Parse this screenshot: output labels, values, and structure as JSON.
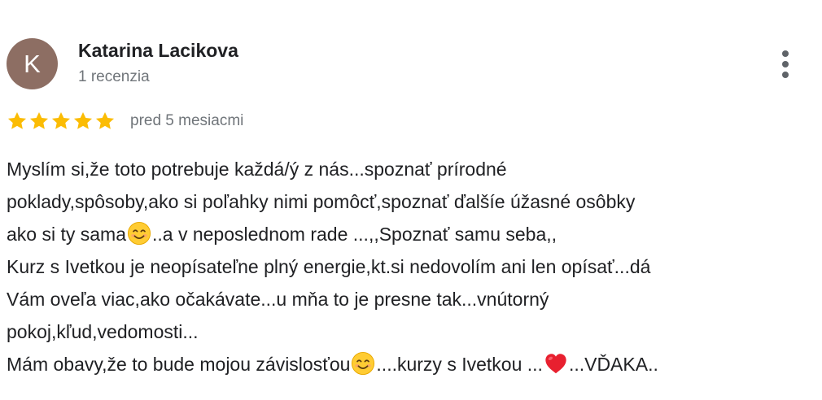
{
  "review": {
    "author": {
      "name": "Katarina Lacikova",
      "initial": "K",
      "review_count": "1 recenzia",
      "avatar_color": "#8d6e63"
    },
    "menu_icon": "more-vert-icon",
    "rating": {
      "stars": 5,
      "max": 5,
      "star_color": "#fbbc04"
    },
    "time_ago": "pred 5 mesiacmi",
    "text_lines": [
      {
        "parts": [
          {
            "text": "Myslím si,že toto potrebuje každá/ý z nás...spoznať prírodné"
          }
        ]
      },
      {
        "parts": [
          {
            "text": "poklady,spôsoby,ako si poľahky nimi pomôcť,spoznať ďalšíe úžasné osôbky"
          }
        ]
      },
      {
        "parts": [
          {
            "text": "ako si ty sama"
          },
          {
            "emoji": "smiling-face-icon"
          },
          {
            "text": "..a v neposlednom rade ...,,Spoznať samu seba,,"
          }
        ]
      },
      {
        "parts": [
          {
            "text": "Kurz s Ivetkou je neopísateľne plný energie,kt.si nedovolím ani len opísať...dá"
          }
        ]
      },
      {
        "parts": [
          {
            "text": "Vám oveľa viac,ako očakávate...u mňa to je presne tak...vnútorný"
          }
        ]
      },
      {
        "parts": [
          {
            "text": "pokoj,kľud,vedomosti..."
          }
        ]
      },
      {
        "parts": [
          {
            "text": "Mám obavy,že to bude mojou závislosťou"
          },
          {
            "emoji": "smiling-face-icon"
          },
          {
            "text": "....kurzy s Ivetkou ..."
          },
          {
            "emoji": "red-heart-icon"
          },
          {
            "text": "...VĎAKA.."
          }
        ]
      }
    ]
  }
}
